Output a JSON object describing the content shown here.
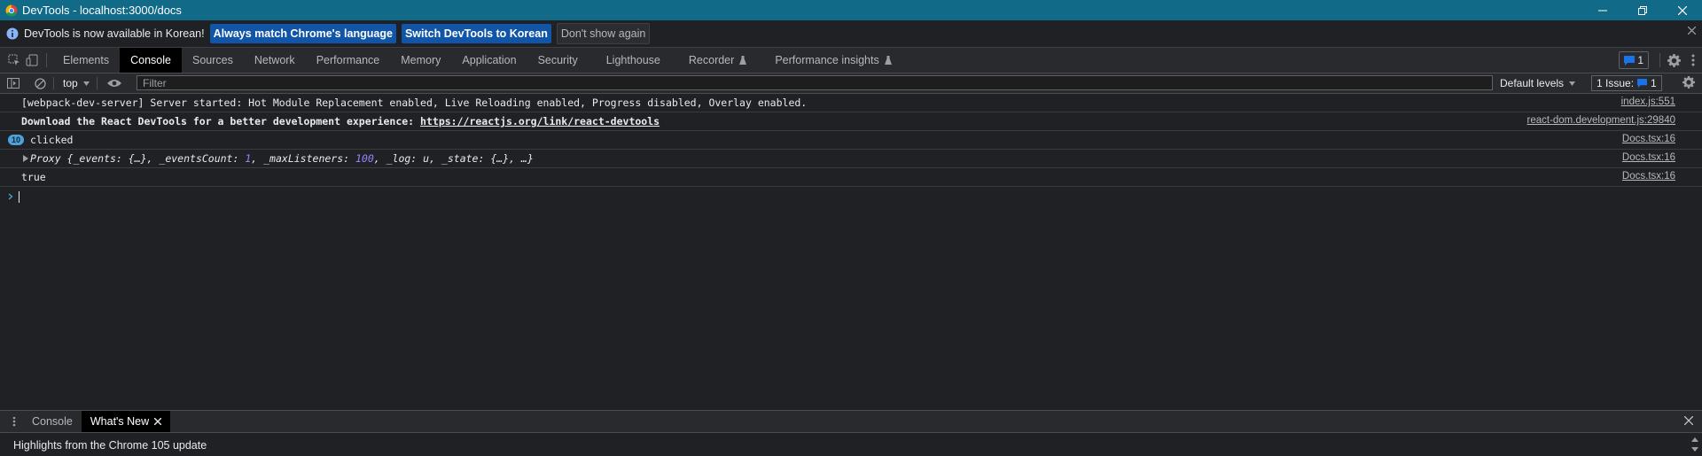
{
  "window": {
    "title": "DevTools - localhost:3000/docs"
  },
  "infobar": {
    "message": "DevTools is now available in Korean!",
    "btn_match": "Always match Chrome's language",
    "btn_switch": "Switch DevTools to Korean",
    "btn_dismiss": "Don't show again"
  },
  "tabs": [
    "Elements",
    "Console",
    "Sources",
    "Network",
    "Performance",
    "Memory",
    "Application",
    "Security",
    "Lighthouse",
    "Recorder",
    "Performance insights"
  ],
  "active_tab": "Console",
  "toolbar_right": {
    "messages_count": "1"
  },
  "console_toolbar": {
    "context": "top",
    "filter_placeholder": "Filter",
    "levels": "Default levels",
    "issues_label": "1 Issue:",
    "issues_count": "1"
  },
  "logs": [
    {
      "text": "[webpack-dev-server] Server started: Hot Module Replacement enabled, Live Reloading enabled, Progress disabled, Overlay enabled.",
      "source": "index.js:551"
    },
    {
      "text": "Download the React DevTools for a better development experience: ",
      "link": "https://reactjs.org/link/react-devtools",
      "source": "react-dom.development.js:29840"
    },
    {
      "count": "10",
      "text": "clicked",
      "source": "Docs.tsx:16"
    },
    {
      "prefix": "Proxy",
      "obj_open": " {_events: {…}, _eventsCount: ",
      "n1": "1",
      "mid": ", _maxListeners: ",
      "n2": "100",
      "rest": ", _log: u, _state: {…}, …}",
      "source": "Docs.tsx:16"
    },
    {
      "text": "true",
      "source": "Docs.tsx:16"
    }
  ],
  "drawer": {
    "tabs": [
      "Console",
      "What's New"
    ],
    "active": "What's New",
    "body": "Highlights from the Chrome 105 update"
  },
  "colors": {
    "titlebar": "#116a88",
    "background": "#202124",
    "accent": "#1a73e8"
  }
}
